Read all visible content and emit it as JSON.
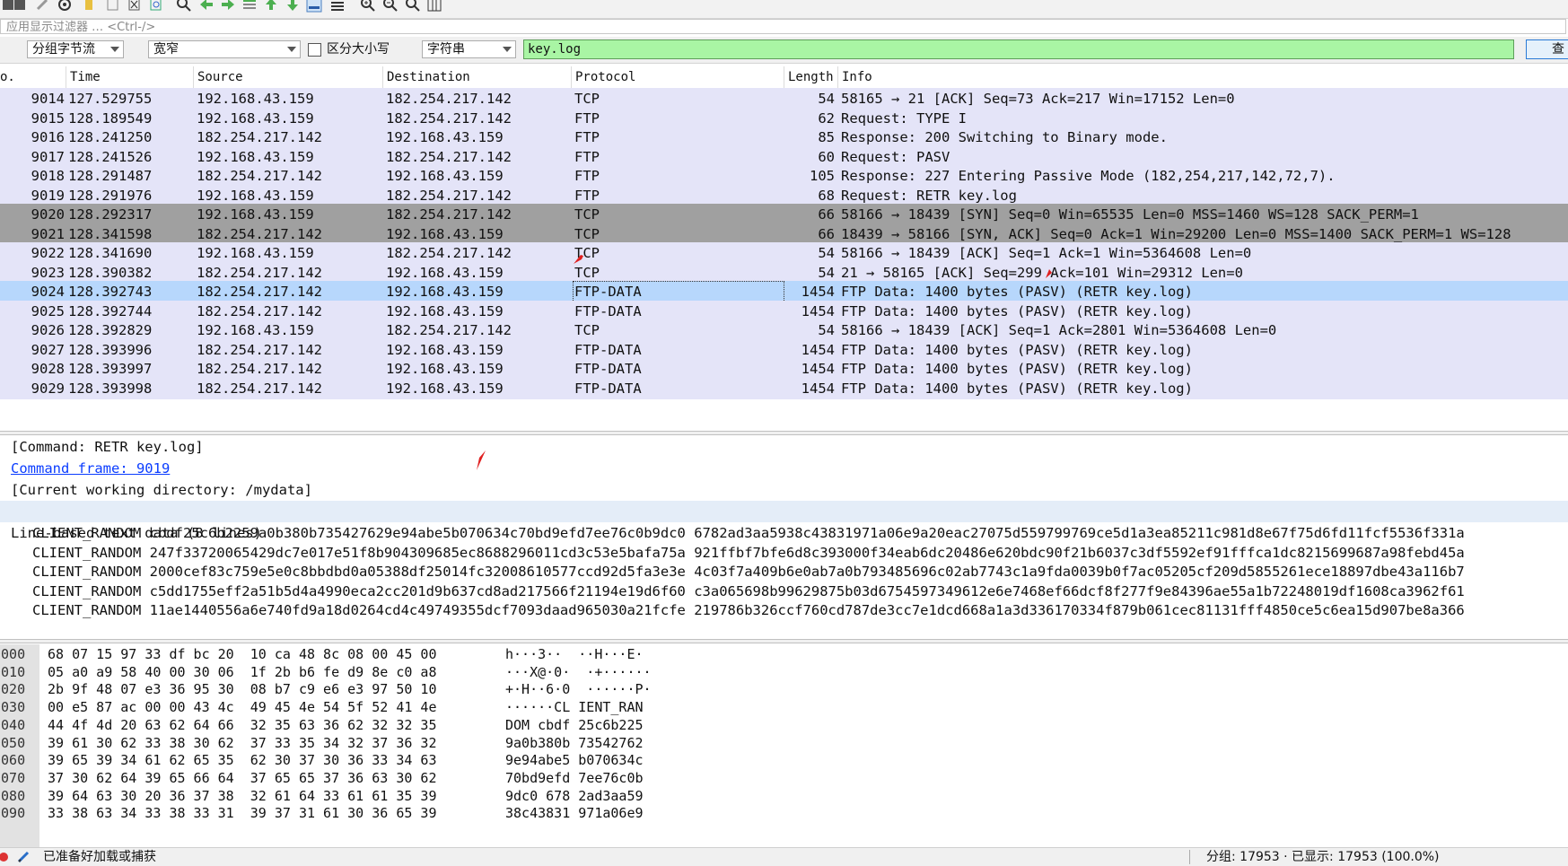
{
  "display_filter": {
    "placeholder": "应用显示过滤器 … <Ctrl-/>"
  },
  "find_bar": {
    "search_in": "分组字节流",
    "char_width": "宽窄",
    "case_sensitive_label": "区分大小写",
    "search_type": "字符串",
    "search_value": "key.log",
    "find_button": "查"
  },
  "columns": [
    "o.",
    "Time",
    "Source",
    "Destination",
    "Protocol",
    "Length",
    "Info"
  ],
  "packets": [
    {
      "no": "9014",
      "time": "127.529755",
      "src": "192.168.43.159",
      "dst": "182.254.217.142",
      "proto": "TCP",
      "len": "54",
      "info": "58165 → 21 [ACK] Seq=73 Ack=217 Win=17152 Len=0"
    },
    {
      "no": "9015",
      "time": "128.189549",
      "src": "192.168.43.159",
      "dst": "182.254.217.142",
      "proto": "FTP",
      "len": "62",
      "info": "Request: TYPE I"
    },
    {
      "no": "9016",
      "time": "128.241250",
      "src": "182.254.217.142",
      "dst": "192.168.43.159",
      "proto": "FTP",
      "len": "85",
      "info": "Response: 200 Switching to Binary mode."
    },
    {
      "no": "9017",
      "time": "128.241526",
      "src": "192.168.43.159",
      "dst": "182.254.217.142",
      "proto": "FTP",
      "len": "60",
      "info": "Request: PASV"
    },
    {
      "no": "9018",
      "time": "128.291487",
      "src": "182.254.217.142",
      "dst": "192.168.43.159",
      "proto": "FTP",
      "len": "105",
      "info": "Response: 227 Entering Passive Mode (182,254,217,142,72,7)."
    },
    {
      "no": "9019",
      "time": "128.291976",
      "src": "192.168.43.159",
      "dst": "182.254.217.142",
      "proto": "FTP",
      "len": "68",
      "info": "Request: RETR key.log"
    },
    {
      "no": "9020",
      "time": "128.292317",
      "src": "192.168.43.159",
      "dst": "182.254.217.142",
      "proto": "TCP",
      "len": "66",
      "info": "58166 → 18439 [SYN] Seq=0 Win=65535 Len=0 MSS=1460 WS=128 SACK_PERM=1"
    },
    {
      "no": "9021",
      "time": "128.341598",
      "src": "182.254.217.142",
      "dst": "192.168.43.159",
      "proto": "TCP",
      "len": "66",
      "info": "18439 → 58166 [SYN, ACK] Seq=0 Ack=1 Win=29200 Len=0 MSS=1400 SACK_PERM=1 WS=128"
    },
    {
      "no": "9022",
      "time": "128.341690",
      "src": "192.168.43.159",
      "dst": "182.254.217.142",
      "proto": "TCP",
      "len": "54",
      "info": "58166 → 18439 [ACK] Seq=1 Ack=1 Win=5364608 Len=0"
    },
    {
      "no": "9023",
      "time": "128.390382",
      "src": "182.254.217.142",
      "dst": "192.168.43.159",
      "proto": "TCP",
      "len": "54",
      "info": "21 → 58165 [ACK] Seq=299 Ack=101 Win=29312 Len=0"
    },
    {
      "no": "9024",
      "time": "128.392743",
      "src": "182.254.217.142",
      "dst": "192.168.43.159",
      "proto": "FTP-DATA",
      "len": "1454",
      "info": "FTP Data: 1400 bytes (PASV) (RETR key.log)"
    },
    {
      "no": "9025",
      "time": "128.392744",
      "src": "182.254.217.142",
      "dst": "192.168.43.159",
      "proto": "FTP-DATA",
      "len": "1454",
      "info": "FTP Data: 1400 bytes (PASV) (RETR key.log)"
    },
    {
      "no": "9026",
      "time": "128.392829",
      "src": "192.168.43.159",
      "dst": "182.254.217.142",
      "proto": "TCP",
      "len": "54",
      "info": "58166 → 18439 [ACK] Seq=1 Ack=2801 Win=5364608 Len=0"
    },
    {
      "no": "9027",
      "time": "128.393996",
      "src": "182.254.217.142",
      "dst": "192.168.43.159",
      "proto": "FTP-DATA",
      "len": "1454",
      "info": "FTP Data: 1400 bytes (PASV) (RETR key.log)"
    },
    {
      "no": "9028",
      "time": "128.393997",
      "src": "182.254.217.142",
      "dst": "192.168.43.159",
      "proto": "FTP-DATA",
      "len": "1454",
      "info": "FTP Data: 1400 bytes (PASV) (RETR key.log)"
    },
    {
      "no": "9029",
      "time": "128.393998",
      "src": "182.254.217.142",
      "dst": "192.168.43.159",
      "proto": "FTP-DATA",
      "len": "1454",
      "info": "FTP Data: 1400 bytes (PASV) (RETR key.log)"
    }
  ],
  "details": {
    "command": "[Command: RETR key.log]",
    "command_frame": "Command frame: 9019",
    "cwd": "[Current working directory: /mydata]",
    "line_based": "Line-based text data (8 lines)",
    "lines": [
      "CLIENT_RANDOM cbdf25c6b2259a0b380b735427629e94abe5b070634c70bd9efd7ee76c0b9dc0 6782ad3aa5938c43831971a06e9a20eac27075d559799769ce5d1a3ea85211c981d8e67f75d6fd11fcf5536f331a",
      "CLIENT_RANDOM 247f33720065429dc7e017e51f8b904309685ec8688296011cd3c53e5bafa75a 921ffbf7bfe6d8c393000f34eab6dc20486e620bdc90f21b6037c3df5592ef91fffca1dc8215699687a98febd45a",
      "CLIENT_RANDOM 2000cef83c759e5e0c8bbdbd0a05388df25014fc32008610577ccd92d5fa3e3e 4c03f7a409b6e0ab7a0b793485696c02ab7743c1a9fda0039b0f7ac05205cf209d5855261ece18897dbe43a116b7",
      "CLIENT_RANDOM c5dd1755eff2a51b5d4a4990eca2cc201d9b637cd8ad217566f21194e19d6f60 c3a065698b99629875b03d6754597349612e6e7468ef66dcf8f277f9e84396ae55a1b72248019df1608ca3962f61",
      "CLIENT_RANDOM 11ae1440556a6e740fd9a18d0264cd4c49749355dcf7093daad965030a21fcfe 219786b326ccf760cd787de3cc7e1dcd668a1a3d336170334f879b061cec81131fff4850ce5c6ea15d907be8a366"
    ]
  },
  "bytes": [
    {
      "off": "0000",
      "hex": "68 07 15 97 33 df bc 20  10 ca 48 8c 08 00 45 00",
      "ascii": "h···3··  ··H···E·"
    },
    {
      "off": "0010",
      "hex": "05 a0 a9 58 40 00 30 06  1f 2b b6 fe d9 8e c0 a8",
      "ascii": "···X@·0·  ·+······"
    },
    {
      "off": "0020",
      "hex": "2b 9f 48 07 e3 36 95 30  08 b7 c9 e6 e3 97 50 10",
      "ascii": "+·H··6·0  ······P·"
    },
    {
      "off": "0030",
      "hex": "00 e5 87 ac 00 00 43 4c  49 45 4e 54 5f 52 41 4e",
      "ascii": "······CL IENT_RAN"
    },
    {
      "off": "0040",
      "hex": "44 4f 4d 20 63 62 64 66  32 35 63 36 62 32 32 35",
      "ascii": "DOM cbdf 25c6b225"
    },
    {
      "off": "0050",
      "hex": "39 61 30 62 33 38 30 62  37 33 35 34 32 37 36 32",
      "ascii": "9a0b380b 73542762"
    },
    {
      "off": "0060",
      "hex": "39 65 39 34 61 62 65 35  62 30 37 30 36 33 34 63",
      "ascii": "9e94abe5 b070634c"
    },
    {
      "off": "0070",
      "hex": "37 30 62 64 39 65 66 64  37 65 65 37 36 63 30 62",
      "ascii": "70bd9efd 7ee76c0b"
    },
    {
      "off": "0080",
      "hex": "39 64 63 30 20 36 37 38  32 61 64 33 61 61 35 39",
      "ascii": "9dc0 678 2ad3aa59"
    },
    {
      "off": "0090",
      "hex": "33 38 63 34 33 38 33 31  39 37 31 61 30 36 65 39",
      "ascii": "38c43831 971a06e9"
    }
  ],
  "status": {
    "ready": "已准备好加载或捕获",
    "stats": "分组: 17953 · 已显示: 17953 (100.0%)"
  },
  "colors": {
    "row_bg": "#e4e4f8",
    "row_dark": "#a0a0a0",
    "row_selected": "#b7d7fc",
    "search_bg": "#a9f5a4",
    "marker": "#e02020"
  }
}
